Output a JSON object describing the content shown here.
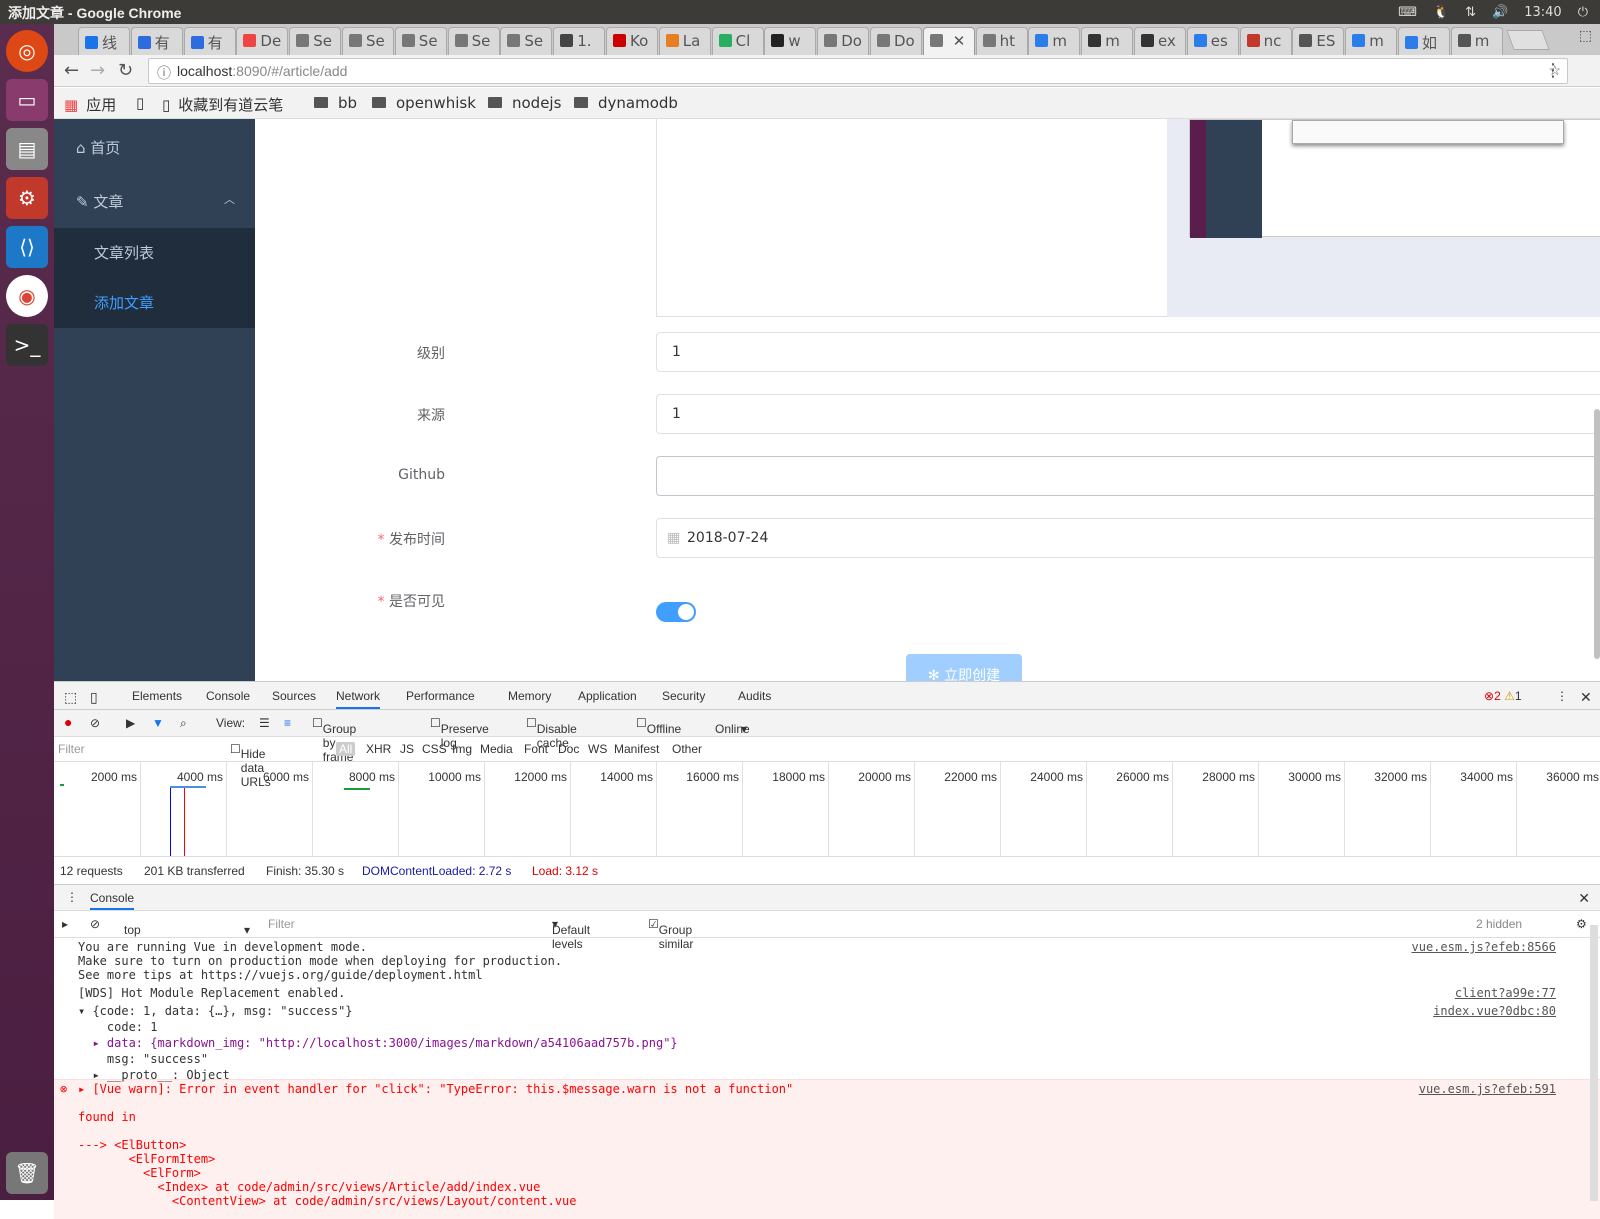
{
  "os": {
    "window_title": "添加文章 - Google Chrome",
    "clock": "13:40"
  },
  "browser": {
    "tabs": [
      "线",
      "有",
      "有",
      "De",
      "Se",
      "Se",
      "Se",
      "Se",
      "Se",
      "1.",
      "Ko",
      "La",
      "Cl",
      "w",
      "Do",
      "Do",
      "",
      "ht",
      "m",
      "m",
      "ex",
      "es",
      "nc",
      "ES",
      "m",
      "如",
      "m"
    ],
    "url_host": "localhost",
    "url_rest": ":8090/#/article/add",
    "bookmarks": [
      "应用",
      "收藏到有道云笔",
      "bb",
      "openwhisk",
      "nodejs",
      "dynamodb"
    ]
  },
  "sidebar": {
    "home": "首页",
    "article": "文章",
    "article_list": "文章列表",
    "add_article": "添加文章"
  },
  "form": {
    "level_label": "级别",
    "level_value": "1",
    "source_label": "来源",
    "source_value": "1",
    "github_label": "Github",
    "github_value": "",
    "publish_label": "发布时间",
    "publish_value": "2018-07-24",
    "visible_label": "是否可见",
    "submit_label": "立即创建",
    "required_mark": "*"
  },
  "devtools": {
    "tabs": [
      "Elements",
      "Console",
      "Sources",
      "Network",
      "Performance",
      "Memory",
      "Application",
      "Security",
      "Audits"
    ],
    "active_tab": "Network",
    "errors": "2",
    "warnings": "1",
    "network_toolbar": {
      "view": "View:",
      "group_by_frame": "Group by frame",
      "preserve_log": "Preserve log",
      "disable_cache": "Disable cache",
      "offline": "Offline",
      "throttle": "Online"
    },
    "filter_placeholder": "Filter",
    "hide_data_urls": "Hide data URLs",
    "filter_types": [
      "All",
      "XHR",
      "JS",
      "CSS",
      "Img",
      "Media",
      "Font",
      "Doc",
      "WS",
      "Manifest",
      "Other"
    ],
    "timeline_ticks": [
      "2000 ms",
      "4000 ms",
      "6000 ms",
      "8000 ms",
      "10000 ms",
      "12000 ms",
      "14000 ms",
      "16000 ms",
      "18000 ms",
      "20000 ms",
      "22000 ms",
      "24000 ms",
      "26000 ms",
      "28000 ms",
      "30000 ms",
      "32000 ms",
      "34000 ms",
      "36000 ms"
    ],
    "summary": {
      "requests": "12 requests",
      "transferred": "201 KB transferred",
      "finish": "Finish: 35.30 s",
      "dom": "DOMContentLoaded: 2.72 s",
      "load": "Load: 3.12 s"
    },
    "console": {
      "tab": "Console",
      "context": "top",
      "filter_placeholder": "Filter",
      "levels": "Default levels",
      "group_similar": "Group similar",
      "hidden": "2 hidden",
      "lines": [
        {
          "text": "You are running Vue in development mode.",
          "src": "vue.esm.js?efeb:8566"
        },
        {
          "text": "Make sure to turn on production mode when deploying for production.",
          "src": ""
        },
        {
          "text": "See more tips at https://vuejs.org/guide/deployment.html",
          "src": ""
        },
        {
          "text": "[WDS] Hot Module Replacement enabled.",
          "src": "client?a99e:77"
        },
        {
          "text": "▾ {code: 1, data: {…}, msg: \"success\"}",
          "src": "index.vue?0dbc:80"
        },
        {
          "text": "    code: 1",
          "src": ""
        },
        {
          "text": "  ▸ data: {markdown_img: \"http://localhost:3000/images/markdown/a54106aad757b.png\"}",
          "src": ""
        },
        {
          "text": "    msg: \"success\"",
          "src": ""
        },
        {
          "text": "  ▸ __proto__: Object",
          "src": ""
        }
      ],
      "error": {
        "text": "▸ [Vue warn]: Error in event handler for \"click\": \"TypeError: this.$message.warn is not a function\"",
        "src": "vue.esm.js?efeb:591",
        "trace": [
          "found in",
          "",
          "---> <ElButton>",
          "       <ElFormItem>",
          "         <ElForm>",
          "           <Index> at code/admin/src/views/Article/add/index.vue",
          "             <ContentView> at code/admin/src/views/Layout/content.vue"
        ]
      }
    }
  }
}
